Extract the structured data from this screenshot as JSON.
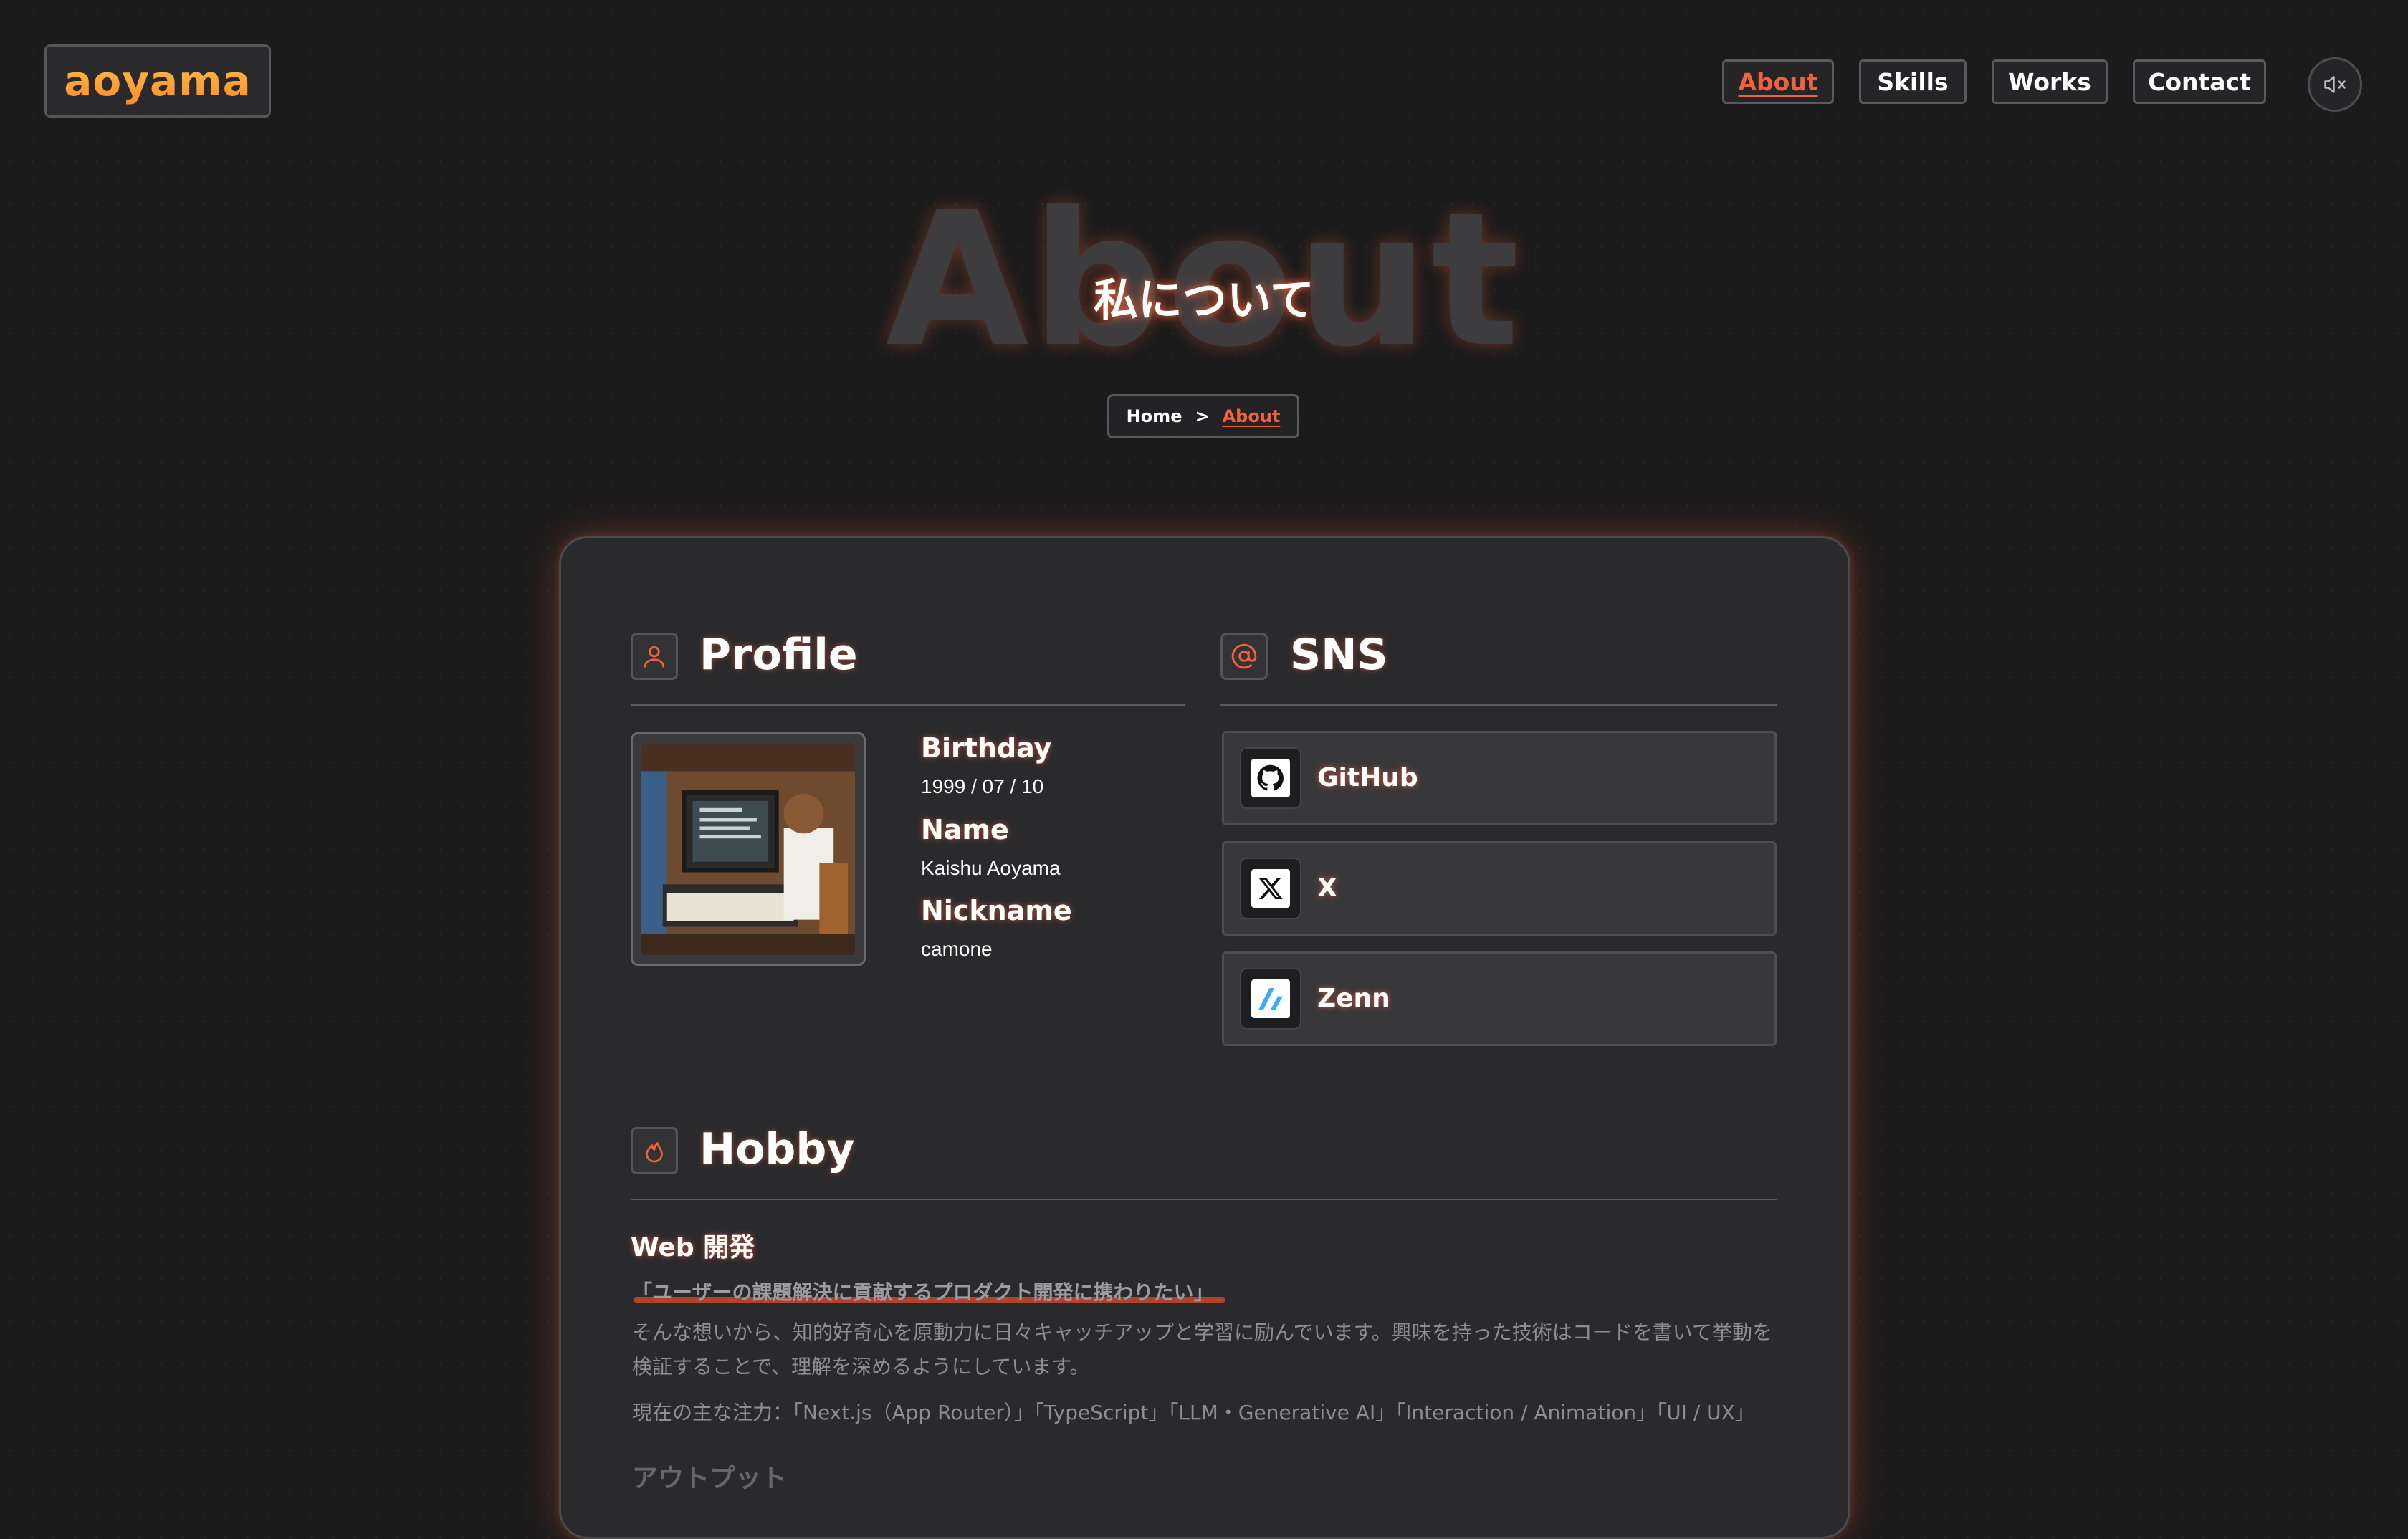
{
  "header": {
    "logo": "aoyama",
    "nav": [
      {
        "label": "About",
        "active": true
      },
      {
        "label": "Skills",
        "active": false
      },
      {
        "label": "Works",
        "active": false
      },
      {
        "label": "Contact",
        "active": false
      }
    ],
    "sound_icon": "speaker-muted-icon"
  },
  "hero": {
    "bg_title": "About",
    "title": "私について"
  },
  "breadcrumb": {
    "home": "Home",
    "separator": ">",
    "current": "About"
  },
  "profile": {
    "heading": "Profile",
    "icon": "user-icon",
    "fields": [
      {
        "label": "Birthday",
        "value": "1999 / 07 / 10"
      },
      {
        "label": "Name",
        "value": "Kaishu Aoyama"
      },
      {
        "label": "Nickname",
        "value": "camone"
      }
    ]
  },
  "sns": {
    "heading": "SNS",
    "icon": "at-icon",
    "items": [
      {
        "label": "GitHub",
        "icon": "github-icon"
      },
      {
        "label": "X",
        "icon": "x-icon"
      },
      {
        "label": "Zenn",
        "icon": "zenn-icon"
      }
    ]
  },
  "hobby": {
    "heading": "Hobby",
    "icon": "flame-icon",
    "subheading": "Web 開発",
    "quote": "「ユーザーの課題解決に貢献するプロダクト開発に携わりたい」",
    "paragraph": "そんな想いから、知的好奇心を原動力に日々キャッチアップと学習に励んでいます。興味を持った技術はコードを書いて挙動を検証することで、理解を深めるようにしています。",
    "focus": "現在の主な注力：「Next.js（App Router）」「TypeScript」「LLM・Generative AI」「Interaction / Animation」「UI / UX」",
    "output_heading": "アウトプット"
  },
  "colors": {
    "accent": "#f0623a",
    "background": "#1b1b1c",
    "card": "#2a2a2c"
  }
}
